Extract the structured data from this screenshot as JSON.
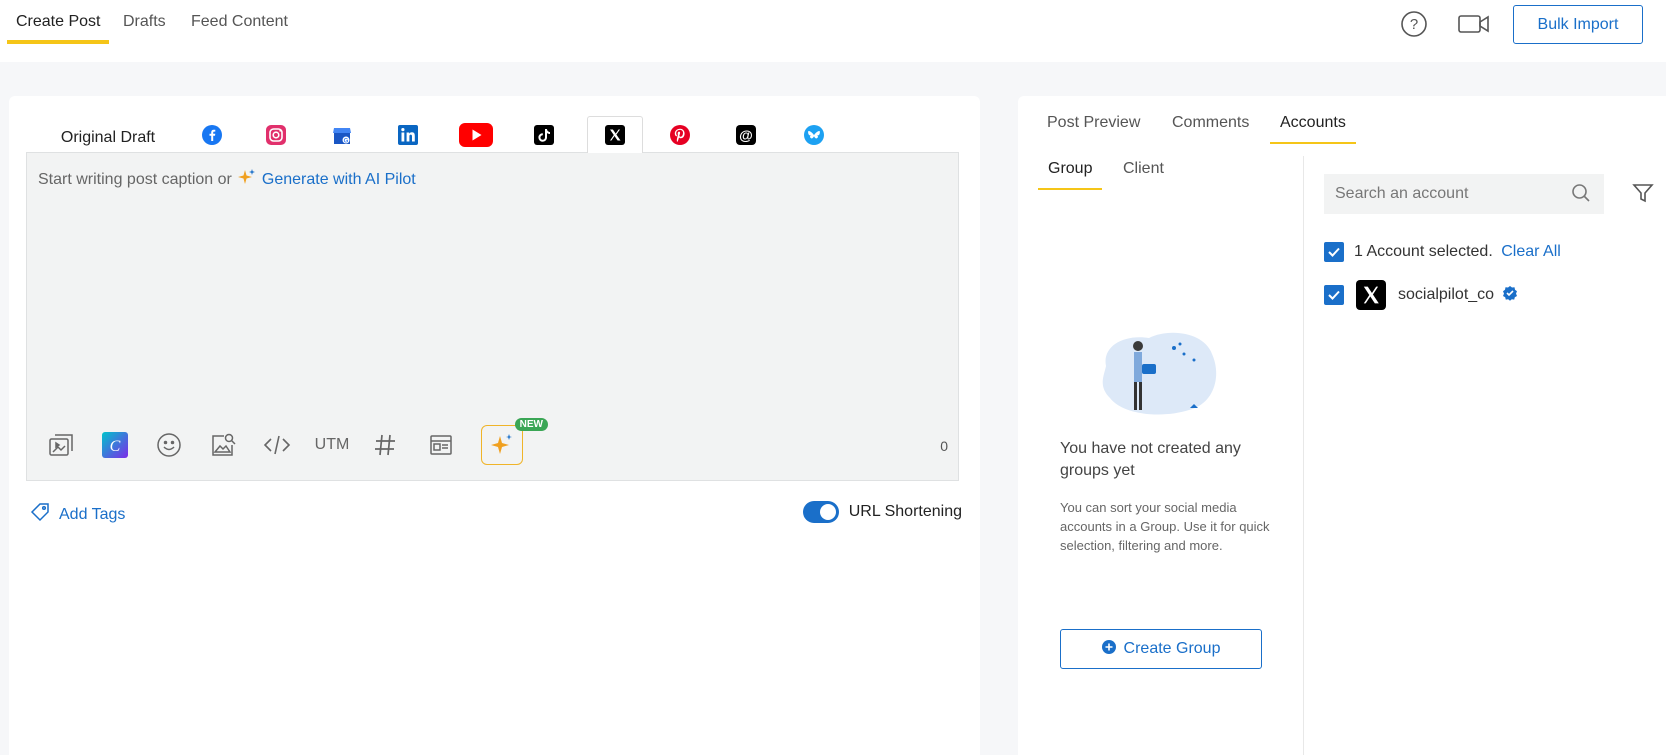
{
  "header": {
    "tabs": [
      {
        "label": "Create Post",
        "active": true
      },
      {
        "label": "Drafts",
        "active": false
      },
      {
        "label": "Feed Content",
        "active": false
      }
    ],
    "help_icon": "help-circle-icon",
    "video_icon": "video-camera-icon",
    "bulk_import_label": "Bulk Import"
  },
  "composer": {
    "original_draft_label": "Original Draft",
    "platforms": [
      "facebook",
      "instagram",
      "google-business",
      "linkedin",
      "youtube",
      "tiktok",
      "x",
      "pinterest",
      "threads",
      "bluesky"
    ],
    "active_platform": "x",
    "placeholder_text": "Start writing post caption or",
    "generate_link": "Generate with AI Pilot",
    "toolbar": {
      "utm_label": "UTM",
      "new_badge": "NEW"
    },
    "char_count": "0",
    "add_tags_label": "Add Tags",
    "url_shortening_label": "URL Shortening",
    "url_shortening_on": true
  },
  "right_panel": {
    "tabs": [
      {
        "label": "Post Preview",
        "active": false
      },
      {
        "label": "Comments",
        "active": false
      },
      {
        "label": "Accounts",
        "active": true
      }
    ],
    "subtabs": [
      {
        "label": "Group",
        "active": true
      },
      {
        "label": "Client",
        "active": false
      }
    ],
    "empty_title": "You have not created any groups yet",
    "empty_desc": "You can sort your social media accounts in a Group. Use it for quick selection, filtering and more.",
    "create_group_label": "Create Group",
    "search_placeholder": "Search an account",
    "selection_text": "1 Account selected.",
    "clear_all_label": "Clear All",
    "accounts": [
      {
        "name": "socialpilot_co",
        "network": "x",
        "verified": true,
        "checked": true
      }
    ]
  },
  "colors": {
    "accent": "#1a6fc9",
    "tab_underline": "#f5c518",
    "new_badge": "#3aa655"
  }
}
